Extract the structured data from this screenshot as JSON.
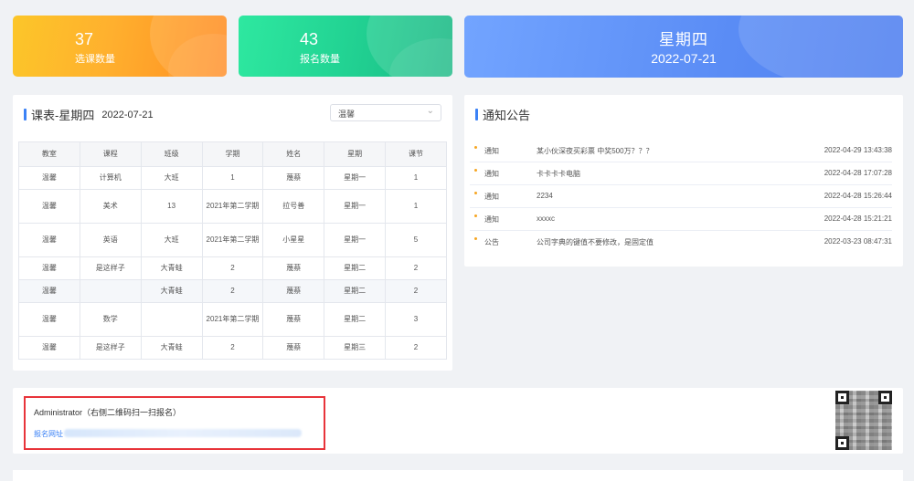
{
  "stats": [
    {
      "value": "37",
      "label": "选课数量"
    },
    {
      "value": "43",
      "label": "报名数量"
    }
  ],
  "today": {
    "weekday": "星期四",
    "date": "2022-07-21"
  },
  "schedule": {
    "title": "课表-星期四",
    "date": "2022-07-21",
    "select_value": "温馨",
    "columns": [
      "教室",
      "课程",
      "班级",
      "学期",
      "姓名",
      "星期",
      "课节"
    ],
    "rows": [
      [
        "温馨",
        "计算机",
        "大班",
        "1",
        "蔑蔡",
        "星期一",
        "1"
      ],
      [
        "温馨",
        "美术",
        "13",
        "2021年第二学期",
        "拉号善",
        "星期一",
        "1"
      ],
      [
        "温馨",
        "英语",
        "大班",
        "2021年第二学期",
        "小星星",
        "星期一",
        "5"
      ],
      [
        "温馨",
        "是这样子",
        "大青蛙",
        "2",
        "蔑蔡",
        "星期二",
        "2"
      ],
      [
        "温馨",
        "",
        "大青蛙",
        "2",
        "蔑蔡",
        "星期二",
        "2"
      ],
      [
        "温馨",
        "数学",
        "",
        "2021年第二学期",
        "蔑蔡",
        "星期二",
        "3"
      ],
      [
        "温馨",
        "是这样子",
        "大青蛙",
        "2",
        "蔑蔡",
        "星期三",
        "2"
      ]
    ]
  },
  "notice": {
    "title": "通知公告",
    "items": [
      {
        "type": "通知",
        "text": "某小伙深夜买彩票 中奖500万？？？",
        "time": "2022-04-29 13:43:38"
      },
      {
        "type": "通知",
        "text": "卡卡卡卡电脑",
        "time": "2022-04-28 17:07:28"
      },
      {
        "type": "通知",
        "text": "2234",
        "time": "2022-04-28 15:26:44"
      },
      {
        "type": "通知",
        "text": "xxxxc",
        "time": "2022-04-28 15:21:21"
      },
      {
        "type": "公告",
        "text": "公司字典的键值不要修改，是固定值",
        "time": "2022-03-23 08:47:31"
      }
    ]
  },
  "registration": {
    "admin_text": "Administrator（右侧二维码扫一扫报名）",
    "url_label": "报名网址"
  },
  "colors": {
    "accent": "#3b82f6",
    "notice_dot": "#f6a623",
    "highlight_border": "#e8343a"
  },
  "icons": {
    "select_arrow": "chevron-down-icon",
    "qr": "qr-code-image"
  }
}
